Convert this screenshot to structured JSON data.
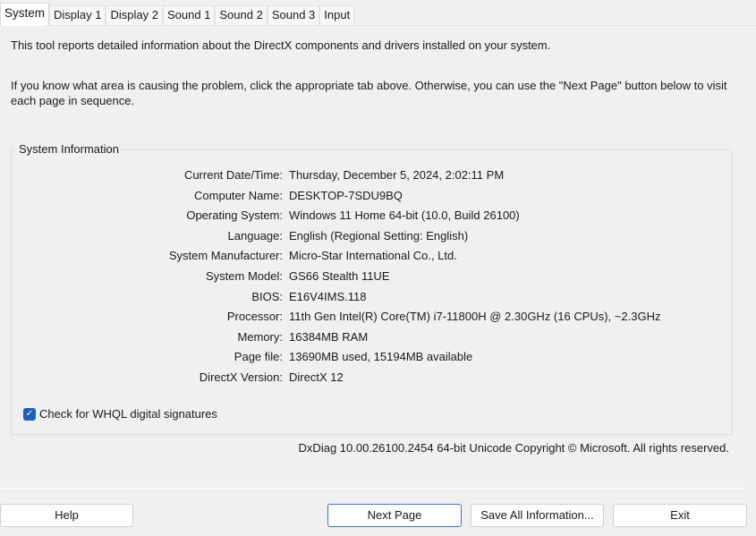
{
  "tabs": [
    "System",
    "Display 1",
    "Display 2",
    "Sound 1",
    "Sound 2",
    "Sound 3",
    "Input"
  ],
  "intro1": "This tool reports detailed information about the DirectX components and drivers installed on your system.",
  "intro2": "If you know what area is causing the problem, click the appropriate tab above.  Otherwise, you can use the \"Next Page\" button below to visit each page in sequence.",
  "group": {
    "title": "System Information",
    "rows": [
      {
        "label": "Current Date/Time:",
        "value": "Thursday, December 5, 2024, 2:02:11 PM"
      },
      {
        "label": "Computer Name:",
        "value": "DESKTOP-7SDU9BQ"
      },
      {
        "label": "Operating System:",
        "value": "Windows 11 Home 64-bit (10.0, Build 26100)"
      },
      {
        "label": "Language:",
        "value": "English (Regional Setting: English)"
      },
      {
        "label": "System Manufacturer:",
        "value": "Micro-Star International Co., Ltd."
      },
      {
        "label": "System Model:",
        "value": "GS66 Stealth 11UE"
      },
      {
        "label": "BIOS:",
        "value": "E16V4IMS.118"
      },
      {
        "label": "Processor:",
        "value": "11th Gen Intel(R) Core(TM) i7-11800H @ 2.30GHz (16 CPUs), ~2.3GHz"
      },
      {
        "label": "Memory:",
        "value": "16384MB RAM"
      },
      {
        "label": "Page file:",
        "value": "13690MB used, 15194MB available"
      },
      {
        "label": "DirectX Version:",
        "value": "DirectX 12"
      }
    ],
    "whql_label": "Check for WHQL digital signatures",
    "whql_checked": true
  },
  "version": "DxDiag 10.00.26100.2454 64-bit Unicode  Copyright © Microsoft. All rights reserved.",
  "buttons": {
    "help": "Help",
    "next": "Next Page",
    "save": "Save All Information...",
    "exit": "Exit"
  },
  "colors": {
    "accent": "#1f5fb5"
  }
}
